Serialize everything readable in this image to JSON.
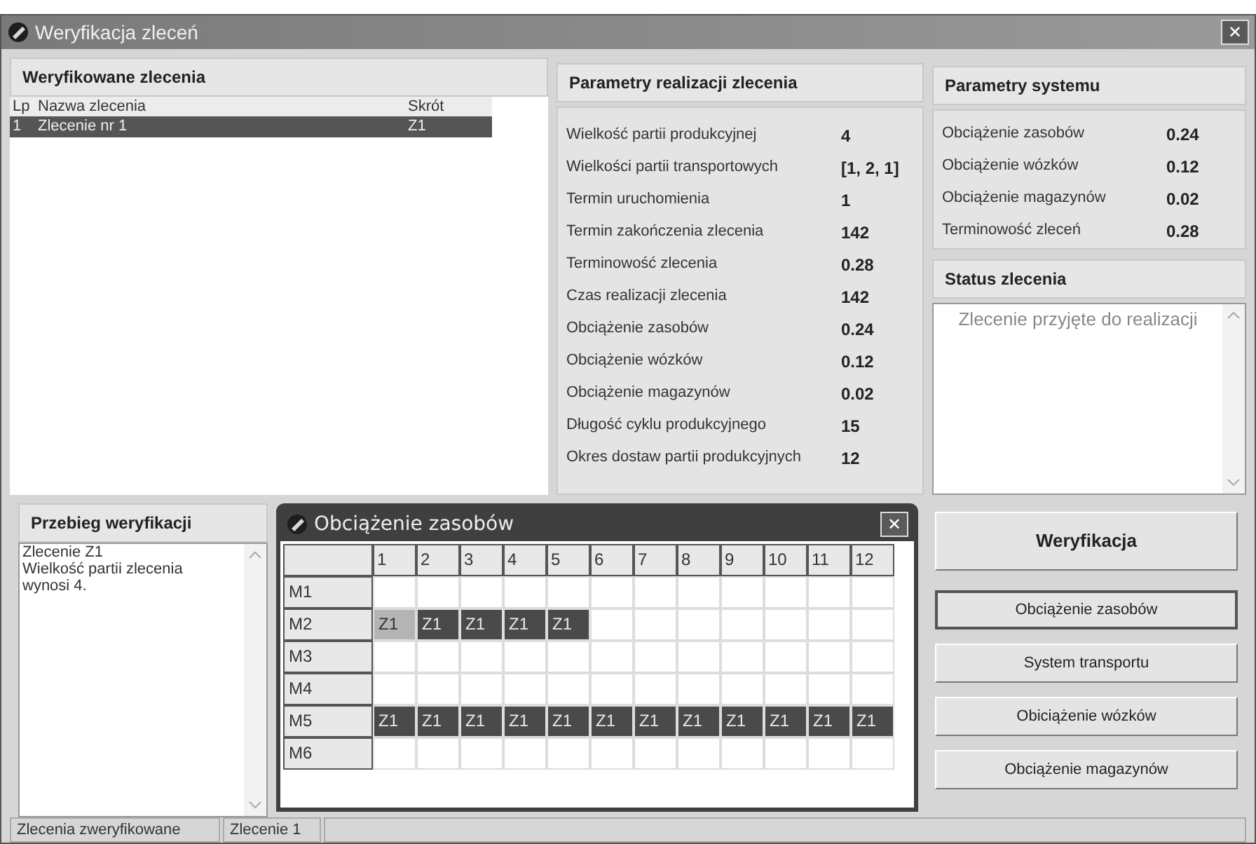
{
  "window": {
    "title": "Weryfikacja zleceń",
    "close": "✕"
  },
  "orders_panel": {
    "title": "Weryfikowane zlecenia",
    "columns": [
      "Lp",
      "Nazwa zlecenia",
      "Skrót"
    ],
    "rows": [
      {
        "cells": [
          "1",
          "Zlecenie nr 1",
          "Z1"
        ],
        "selected": true
      }
    ]
  },
  "params_panel": {
    "title": "Parametry realizacji zlecenia",
    "items": [
      {
        "label": "Wielkość partii produkcyjnej",
        "value": "4"
      },
      {
        "label": "Wielkości partii transportowych",
        "value": "[1, 2, 1]"
      },
      {
        "label": "Termin uruchomienia",
        "value": "1"
      },
      {
        "label": "Termin zakończenia zlecenia",
        "value": "142"
      },
      {
        "label": "Terminowość zlecenia",
        "value": "0.28"
      },
      {
        "label": "Czas realizacji zlecenia",
        "value": "142"
      },
      {
        "label": "Obciążenie zasobów",
        "value": "0.24"
      },
      {
        "label": "Obciążenie wózków",
        "value": "0.12"
      },
      {
        "label": "Obciążenie magazynów",
        "value": "0.02"
      },
      {
        "label": "Długość cyklu produkcyjnego",
        "value": "15"
      },
      {
        "label": "Okres dostaw partii produkcyjnych",
        "value": "12"
      }
    ]
  },
  "system_panel": {
    "title": "Parametry systemu",
    "items": [
      {
        "label": "Obciążenie zasobów",
        "value": "0.24"
      },
      {
        "label": "Obciążenie wózków",
        "value": "0.12"
      },
      {
        "label": "Obciążenie magazynów",
        "value": "0.02"
      },
      {
        "label": "Terminowość zleceń",
        "value": "0.28"
      }
    ]
  },
  "status_panel": {
    "title": "Status zlecenia",
    "text": "Zlecenie przyjęte do realizacji"
  },
  "log_panel": {
    "title": "Przebieg weryfikacji",
    "lines": [
      "Zlecenie Z1",
      "Wielkość partii zlecenia wynosi 4."
    ]
  },
  "load_window": {
    "title": "Obciążenie zasobów",
    "close": "✕",
    "columns": [
      "1",
      "2",
      "3",
      "4",
      "5",
      "6",
      "7",
      "8",
      "9",
      "10",
      "11",
      "12"
    ],
    "rows": [
      {
        "label": "M1",
        "cells": [
          {
            "color": "#ffffff"
          },
          {
            "color": "#ffffff"
          },
          {
            "color": "#ffffff"
          },
          {
            "color": "#ffffff"
          },
          {
            "color": "#ffffff"
          },
          {
            "color": "#ffffff"
          },
          {
            "color": "#ffffff"
          },
          {
            "color": "#ffffff"
          },
          {
            "color": "#ffffff"
          },
          {
            "color": "#ffffff"
          },
          {
            "color": "#ffffff"
          },
          {
            "color": "#ffffff"
          }
        ]
      },
      {
        "label": "M2",
        "cells": [
          {
            "color": "#b4b4b4",
            "text": "Z1"
          },
          {
            "color": "#4a4a4a",
            "text": "Z1"
          },
          {
            "color": "#4a4a4a",
            "text": "Z1"
          },
          {
            "color": "#4a4a4a",
            "text": "Z1"
          },
          {
            "color": "#4a4a4a",
            "text": "Z1"
          },
          {
            "color": "#ffffff"
          },
          {
            "color": "#ffffff"
          },
          {
            "color": "#ffffff"
          },
          {
            "color": "#ffffff"
          },
          {
            "color": "#ffffff"
          },
          {
            "color": "#ffffff"
          },
          {
            "color": "#ffffff"
          }
        ]
      },
      {
        "label": "M3",
        "cells": [
          {
            "color": "#ffffff"
          },
          {
            "color": "#ffffff"
          },
          {
            "color": "#ffffff"
          },
          {
            "color": "#ffffff"
          },
          {
            "color": "#ffffff"
          },
          {
            "color": "#ffffff"
          },
          {
            "color": "#ffffff"
          },
          {
            "color": "#ffffff"
          },
          {
            "color": "#ffffff"
          },
          {
            "color": "#ffffff"
          },
          {
            "color": "#ffffff"
          },
          {
            "color": "#ffffff"
          }
        ]
      },
      {
        "label": "M4",
        "cells": [
          {
            "color": "#ffffff"
          },
          {
            "color": "#ffffff"
          },
          {
            "color": "#ffffff"
          },
          {
            "color": "#ffffff"
          },
          {
            "color": "#ffffff"
          },
          {
            "color": "#ffffff"
          },
          {
            "color": "#ffffff"
          },
          {
            "color": "#ffffff"
          },
          {
            "color": "#ffffff"
          },
          {
            "color": "#ffffff"
          },
          {
            "color": "#ffffff"
          },
          {
            "color": "#ffffff"
          }
        ]
      },
      {
        "label": "M5",
        "cells": [
          {
            "color": "#4a4a4a",
            "text": "Z1"
          },
          {
            "color": "#4a4a4a",
            "text": "Z1"
          },
          {
            "color": "#4a4a4a",
            "text": "Z1"
          },
          {
            "color": "#4a4a4a",
            "text": "Z1"
          },
          {
            "color": "#4a4a4a",
            "text": "Z1"
          },
          {
            "color": "#4a4a4a",
            "text": "Z1"
          },
          {
            "color": "#4a4a4a",
            "text": "Z1"
          },
          {
            "color": "#4a4a4a",
            "text": "Z1"
          },
          {
            "color": "#4a4a4a",
            "text": "Z1"
          },
          {
            "color": "#4a4a4a",
            "text": "Z1"
          },
          {
            "color": "#4a4a4a",
            "text": "Z1"
          },
          {
            "color": "#4a4a4a",
            "text": "Z1"
          }
        ]
      },
      {
        "label": "M6",
        "cells": [
          {
            "color": "#ffffff"
          },
          {
            "color": "#ffffff"
          },
          {
            "color": "#ffffff"
          },
          {
            "color": "#ffffff"
          },
          {
            "color": "#ffffff"
          },
          {
            "color": "#ffffff"
          },
          {
            "color": "#ffffff"
          },
          {
            "color": "#ffffff"
          },
          {
            "color": "#ffffff"
          },
          {
            "color": "#ffffff"
          },
          {
            "color": "#ffffff"
          },
          {
            "color": "#ffffff"
          }
        ]
      }
    ]
  },
  "buttons": [
    {
      "label": "Weryfikacja",
      "kind": "primary",
      "selected": false
    },
    {
      "label": "Obciążenie zasobów",
      "kind": "normal",
      "selected": true
    },
    {
      "label": "System transportu",
      "kind": "normal",
      "selected": false
    },
    {
      "label": "Obiciążenie wózków",
      "kind": "normal",
      "selected": false
    },
    {
      "label": "Obciążenie magazynów",
      "kind": "normal",
      "selected": false
    }
  ],
  "status_bar": [
    "Zlecenia zweryfikowane",
    "Zlecenie 1"
  ]
}
